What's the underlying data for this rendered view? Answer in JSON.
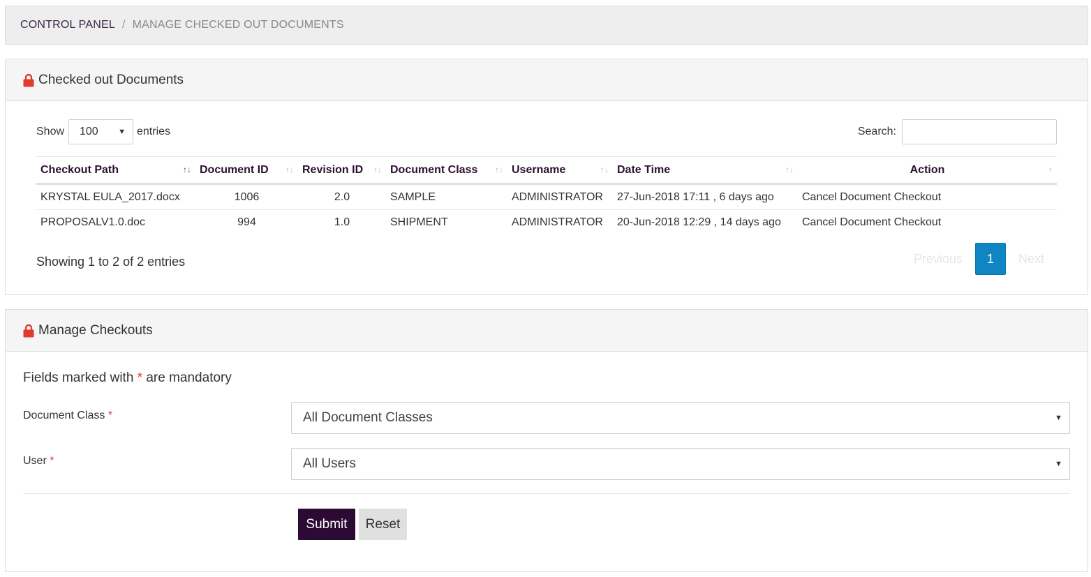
{
  "breadcrumb": {
    "root": "CONTROL PANEL",
    "separator": "/",
    "current": "MANAGE CHECKED OUT DOCUMENTS"
  },
  "checked_out_panel": {
    "title": "Checked out Documents",
    "icon": "lock-icon",
    "length_label_before": "Show",
    "length_value": "100",
    "length_label_after": "entries",
    "search_label": "Search:",
    "search_value": "",
    "columns": [
      "Checkout Path",
      "Document ID",
      "Revision ID",
      "Document Class",
      "Username",
      "Date Time",
      "Action"
    ],
    "rows": [
      {
        "checkout_path": "KRYSTAL EULA_2017.docx",
        "document_id": "1006",
        "revision_id": "2.0",
        "document_class": "SAMPLE",
        "username": "ADMINISTRATOR",
        "date_time": "27-Jun-2018 17:11 , 6 days ago",
        "action": "Cancel Document Checkout"
      },
      {
        "checkout_path": "PROPOSALV1.0.doc",
        "document_id": "994",
        "revision_id": "1.0",
        "document_class": "SHIPMENT",
        "username": "ADMINISTRATOR",
        "date_time": "20-Jun-2018 12:29 , 14 days ago",
        "action": "Cancel Document Checkout"
      }
    ],
    "info": "Showing 1 to 2 of 2 entries",
    "pager": {
      "previous": "Previous",
      "current_page": "1",
      "next": "Next"
    }
  },
  "manage_panel": {
    "title": "Manage Checkouts",
    "icon": "lock-icon",
    "note_before": "Fields marked with",
    "required_mark": "*",
    "note_after": "are mandatory",
    "document_class_label": "Document Class",
    "document_class_value": "All Document Classes",
    "user_label": "User",
    "user_value": "All Users",
    "submit_label": "Submit",
    "reset_label": "Reset"
  },
  "colors": {
    "primary_dark": "#2d0a33",
    "pager_active": "#0f86c1",
    "lock_icon": "#e23b2e",
    "required": "#e23b3b"
  }
}
